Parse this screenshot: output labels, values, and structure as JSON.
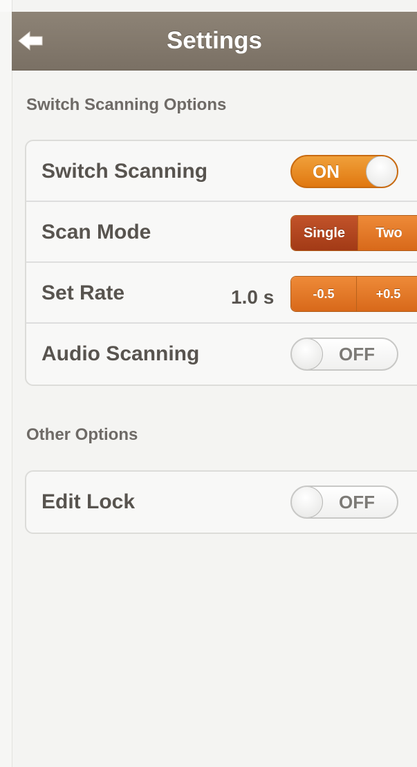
{
  "nav": {
    "title": "Settings"
  },
  "sections": {
    "switch": {
      "header": "Switch Scanning Options",
      "switch_scanning": {
        "label": "Switch Scanning",
        "state": "ON"
      },
      "scan_mode": {
        "label": "Scan Mode",
        "options": [
          "Single",
          "Two"
        ],
        "selected": "Single"
      },
      "set_rate": {
        "label": "Set Rate",
        "value": "1.0 s",
        "decrease": "-0.5",
        "increase": "+0.5"
      },
      "audio_scanning": {
        "label": "Audio Scanning",
        "state": "OFF"
      }
    },
    "other": {
      "header": "Other Options",
      "edit_lock": {
        "label": "Edit Lock",
        "state": "OFF"
      }
    }
  },
  "colors": {
    "navbar": "#7f7569",
    "accent": "#e07810",
    "segment_selected": "#a23a16"
  },
  "icons": {
    "back": "arrow-left-icon"
  }
}
